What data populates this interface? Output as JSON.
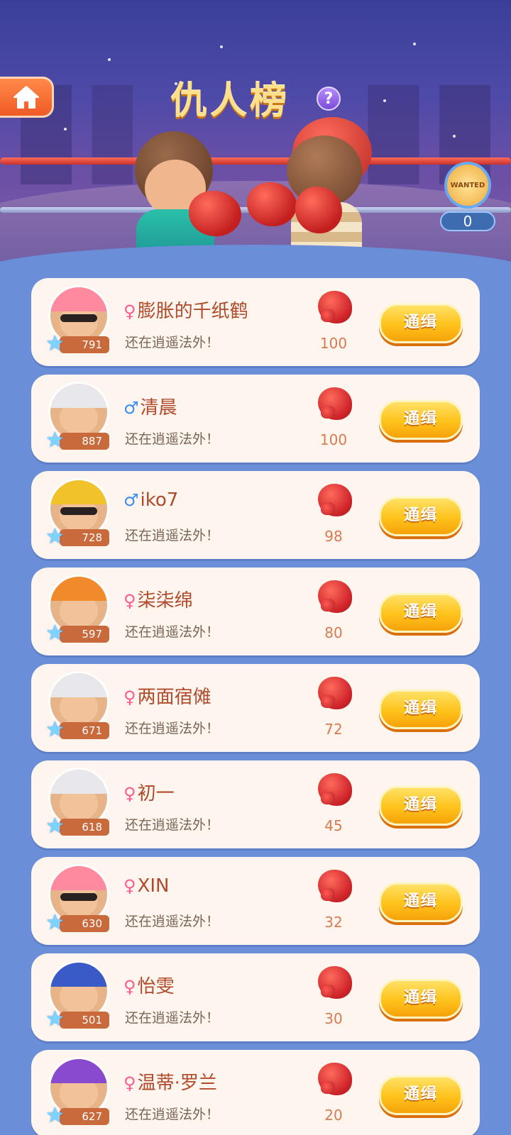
{
  "header": {
    "title": "仇人榜",
    "help_label": "?",
    "home_icon": "home-icon",
    "wanted_badge": {
      "label": "WANTED",
      "count": "0"
    }
  },
  "status_text": "还在逍遥法外！",
  "button_label": "通缉",
  "players": [
    {
      "gender": "♀",
      "gender_type": "f",
      "name": "膨胀的千纸鹤",
      "level": "791",
      "hits": "100",
      "hat": "#ff8aa0",
      "glasses": true
    },
    {
      "gender": "♂",
      "gender_type": "m",
      "name": "清晨",
      "level": "887",
      "hits": "100",
      "hat": "#e8e8ec",
      "glasses": false
    },
    {
      "gender": "♂",
      "gender_type": "m",
      "name": "iko7",
      "level": "728",
      "hits": "98",
      "hat": "#f2c22a",
      "glasses": true
    },
    {
      "gender": "♀",
      "gender_type": "f",
      "name": "柒柒绵",
      "level": "597",
      "hits": "80",
      "hat": "#f08a2a",
      "glasses": false
    },
    {
      "gender": "♀",
      "gender_type": "f",
      "name": "两面宿傩",
      "level": "671",
      "hits": "72",
      "hat": "#e8e8ec",
      "glasses": false
    },
    {
      "gender": "♀",
      "gender_type": "f",
      "name": "初一",
      "level": "618",
      "hits": "45",
      "hat": "#e8e8ec",
      "glasses": false
    },
    {
      "gender": "♀",
      "gender_type": "f",
      "name": "XIN",
      "level": "630",
      "hits": "32",
      "hat": "#ff8aa0",
      "glasses": true
    },
    {
      "gender": "♀",
      "gender_type": "f",
      "name": "怡雯",
      "level": "501",
      "hits": "30",
      "hat": "#3a5ac8",
      "glasses": false
    },
    {
      "gender": "♀",
      "gender_type": "f",
      "name": "温蒂·罗兰",
      "level": "627",
      "hits": "20",
      "hat": "#8a4ad0",
      "glasses": false
    }
  ]
}
